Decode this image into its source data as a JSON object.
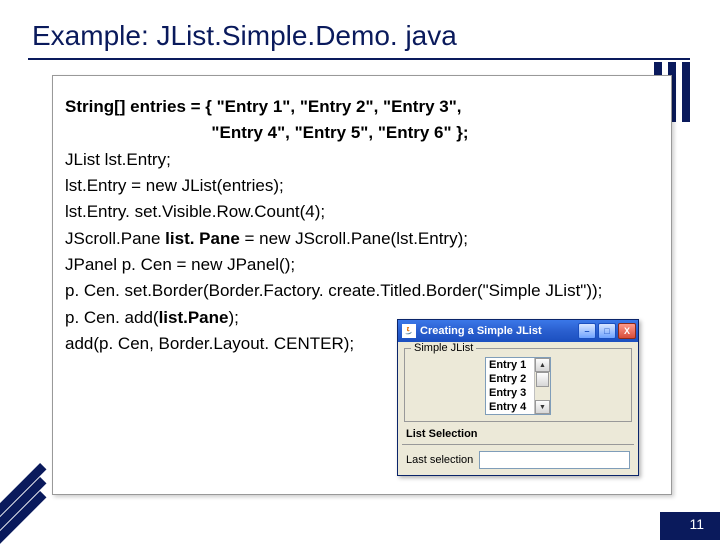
{
  "slide": {
    "title": "Example: JList.Simple.Demo. java",
    "page_number": "11"
  },
  "code": {
    "lines": [
      {
        "text": "String[] entries = { \"Entry 1\", \"Entry 2\", \"Entry 3\",",
        "bold": true,
        "indent": 0
      },
      {
        "text": "                               \"Entry 4\", \"Entry 5\", \"Entry 6\" };",
        "bold": true,
        "indent": 0
      },
      {
        "text": "JList lst.Entry;",
        "bold": false,
        "indent": 0
      },
      {
        "text": "lst.Entry = new JList(entries);",
        "bold": false,
        "indent": 0
      },
      {
        "text": "lst.Entry. set.Visible.Row.Count(4);",
        "bold": false,
        "indent": 0
      },
      {
        "text_parts": [
          {
            "t": "JScroll.Pane ",
            "b": false
          },
          {
            "t": "list. Pane",
            "b": true
          },
          {
            "t": " = new JScroll.Pane(lst.Entry);",
            "b": false
          }
        ],
        "indent": 0
      },
      {
        "text": "JPanel p. Cen = new JPanel();",
        "bold": false,
        "indent": 0
      },
      {
        "text": "p. Cen. set.Border(Border.Factory. create.Titled.Border(\"Simple JList\"));",
        "bold": false,
        "indent": 0
      },
      {
        "text_parts": [
          {
            "t": "p. Cen. add(",
            "b": false
          },
          {
            "t": "list.Pane",
            "b": true
          },
          {
            "t": ");",
            "b": false
          }
        ],
        "indent": 0
      },
      {
        "text": "add(p. Cen, Border.Layout. CENTER);",
        "bold": false,
        "indent": 0
      }
    ]
  },
  "window": {
    "title": "Creating a Simple JList",
    "min_label": "–",
    "max_label": "□",
    "close_label": "X",
    "titled_border_label": "Simple JList",
    "list_items": [
      "Entry 1",
      "Entry 2",
      "Entry 3",
      "Entry 4"
    ],
    "up_arrow": "▲",
    "down_arrow": "▼",
    "list_selection_label": "List Selection",
    "last_selection_label": "Last selection"
  }
}
